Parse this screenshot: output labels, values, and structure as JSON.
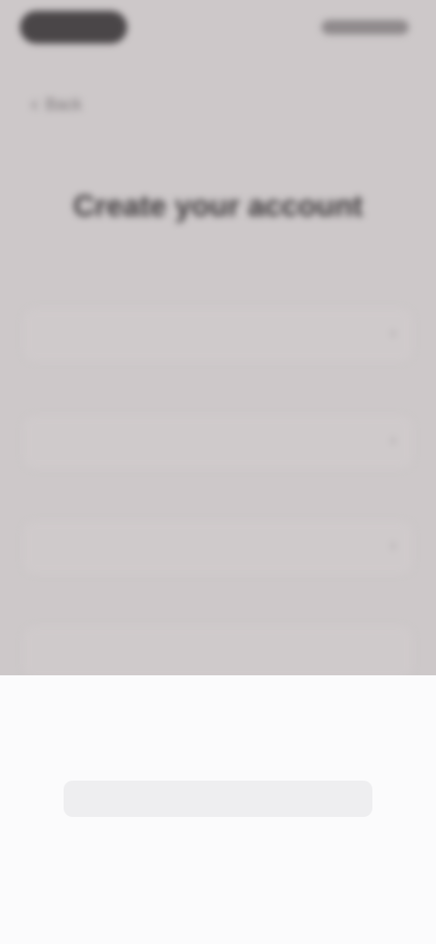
{
  "status_bar": {
    "left_icon": "status-pill",
    "right_icon": "status-icons"
  },
  "nav": {
    "back_label": "Back",
    "back_icon": "chevron-left-icon"
  },
  "page": {
    "title": "Create your account"
  },
  "form": {
    "fields": [
      {
        "label": "",
        "value": "",
        "icon": "chevron-right-icon"
      },
      {
        "label": "",
        "value": "",
        "icon": "chevron-right-icon"
      },
      {
        "label": "",
        "value": "",
        "icon": "chevron-right-icon"
      },
      {
        "label": "",
        "value": "",
        "icon": ""
      }
    ]
  },
  "picker": {
    "column_1": [
      "",
      "",
      "",
      "",
      ""
    ],
    "column_2": [
      "",
      "",
      "",
      "",
      ""
    ],
    "selected_index": 2
  }
}
